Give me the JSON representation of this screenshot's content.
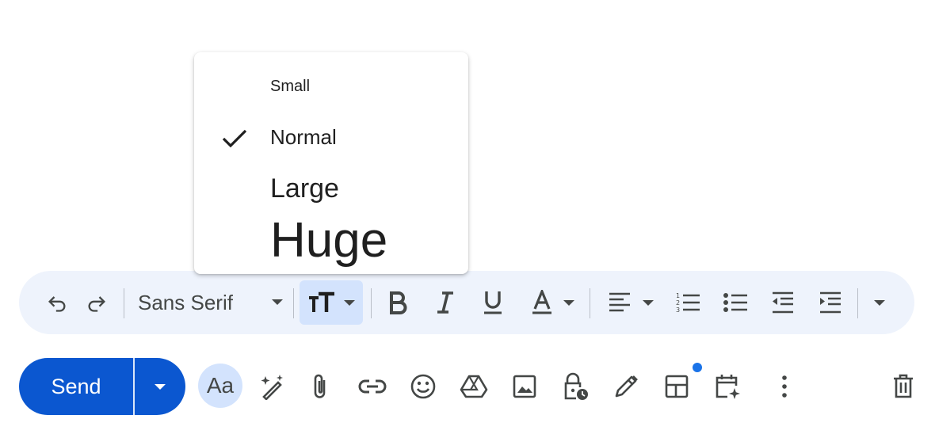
{
  "size_menu": {
    "items": [
      {
        "label": "Small",
        "checked": false
      },
      {
        "label": "Normal",
        "checked": true
      },
      {
        "label": "Large",
        "checked": false
      },
      {
        "label": "Huge",
        "checked": false
      }
    ]
  },
  "toolbar": {
    "font_family": "Sans Serif",
    "icons": [
      "undo-icon",
      "redo-icon",
      "text-size-icon",
      "bold-icon",
      "italic-icon",
      "underline-icon",
      "text-color-icon",
      "align-icon",
      "numbered-list-icon",
      "bulleted-list-icon",
      "indent-less-icon",
      "indent-more-icon",
      "more-formatting-icon"
    ]
  },
  "actions": {
    "send_label": "Send",
    "formatting_label": "Aa",
    "icons": [
      "help-me-write-icon",
      "attach-icon",
      "link-icon",
      "emoji-icon",
      "drive-icon",
      "photo-icon",
      "confidential-icon",
      "signature-icon",
      "layouts-icon",
      "schedule-icon",
      "more-options-icon",
      "discard-icon"
    ]
  },
  "colors": {
    "accent": "#0b57d0",
    "toolbar_bg": "#eef3fc",
    "selected_bg": "#d3e3fd",
    "notification_dot": "#1a73e8"
  }
}
